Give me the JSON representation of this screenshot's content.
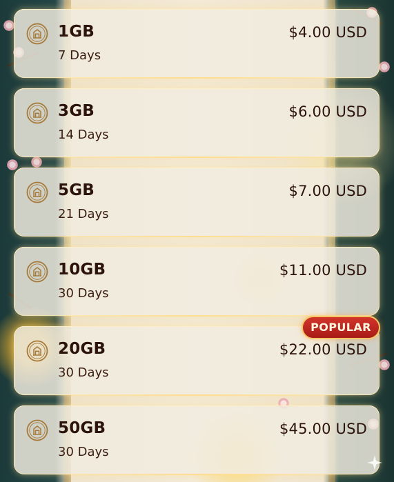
{
  "plans": [
    {
      "size": "1GB",
      "days": "7 Days",
      "price": "$4.00 USD"
    },
    {
      "size": "3GB",
      "days": "14 Days",
      "price": "$6.00 USD"
    },
    {
      "size": "5GB",
      "days": "21 Days",
      "price": "$7.00 USD"
    },
    {
      "size": "10GB",
      "days": "30 Days",
      "price": "$11.00 USD"
    },
    {
      "size": "20GB",
      "days": "30 Days",
      "price": "$22.00 USD",
      "badge": "POPULAR"
    },
    {
      "size": "50GB",
      "days": "30 Days",
      "price": "$45.00 USD"
    }
  ],
  "colors": {
    "card_background": "#f1ece0",
    "text_dark": "#2c130b",
    "badge_red": "#b92922",
    "badge_border": "#f3c869"
  },
  "icons": {
    "plan_icon": "building-coin-icon",
    "corner_icon": "sparkle-icon"
  }
}
